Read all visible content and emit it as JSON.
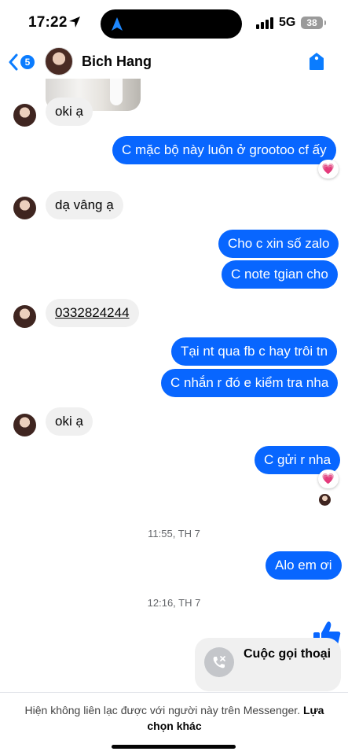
{
  "status_bar": {
    "time": "17:22",
    "network": "5G",
    "battery": "38"
  },
  "header": {
    "back_count": "5",
    "contact_name": "Bich Hang"
  },
  "messages": [
    {
      "text": "oki ạ"
    },
    {
      "text": "C mặc bộ này luôn ở grootoo cf ấy",
      "reaction": "💗"
    },
    {
      "text": "dạ vâng ạ"
    },
    {
      "text": "Cho c xin số zalo"
    },
    {
      "text": "C note tgian cho"
    },
    {
      "text": "0332824244"
    },
    {
      "text": "Tại nt qua fb c hay trôi tn"
    },
    {
      "text": "C nhắn r đó e kiểm tra nha"
    },
    {
      "text": "oki ạ"
    },
    {
      "text": "C gửi r nha",
      "reaction": "💗"
    },
    {
      "text": "Alo em ơi"
    }
  ],
  "timestamps": [
    "11:55, TH 7",
    "12:16, TH 7"
  ],
  "call_card": {
    "title": "Cuộc gọi thoại"
  },
  "footer": {
    "notice": "Hiện không liên lạc được với người này trên Messenger.",
    "link": "Lựa chọn khác"
  },
  "colors": {
    "outgoing": "#0866ff",
    "incoming": "#f0f0f0",
    "accent": "#0a7cff"
  }
}
